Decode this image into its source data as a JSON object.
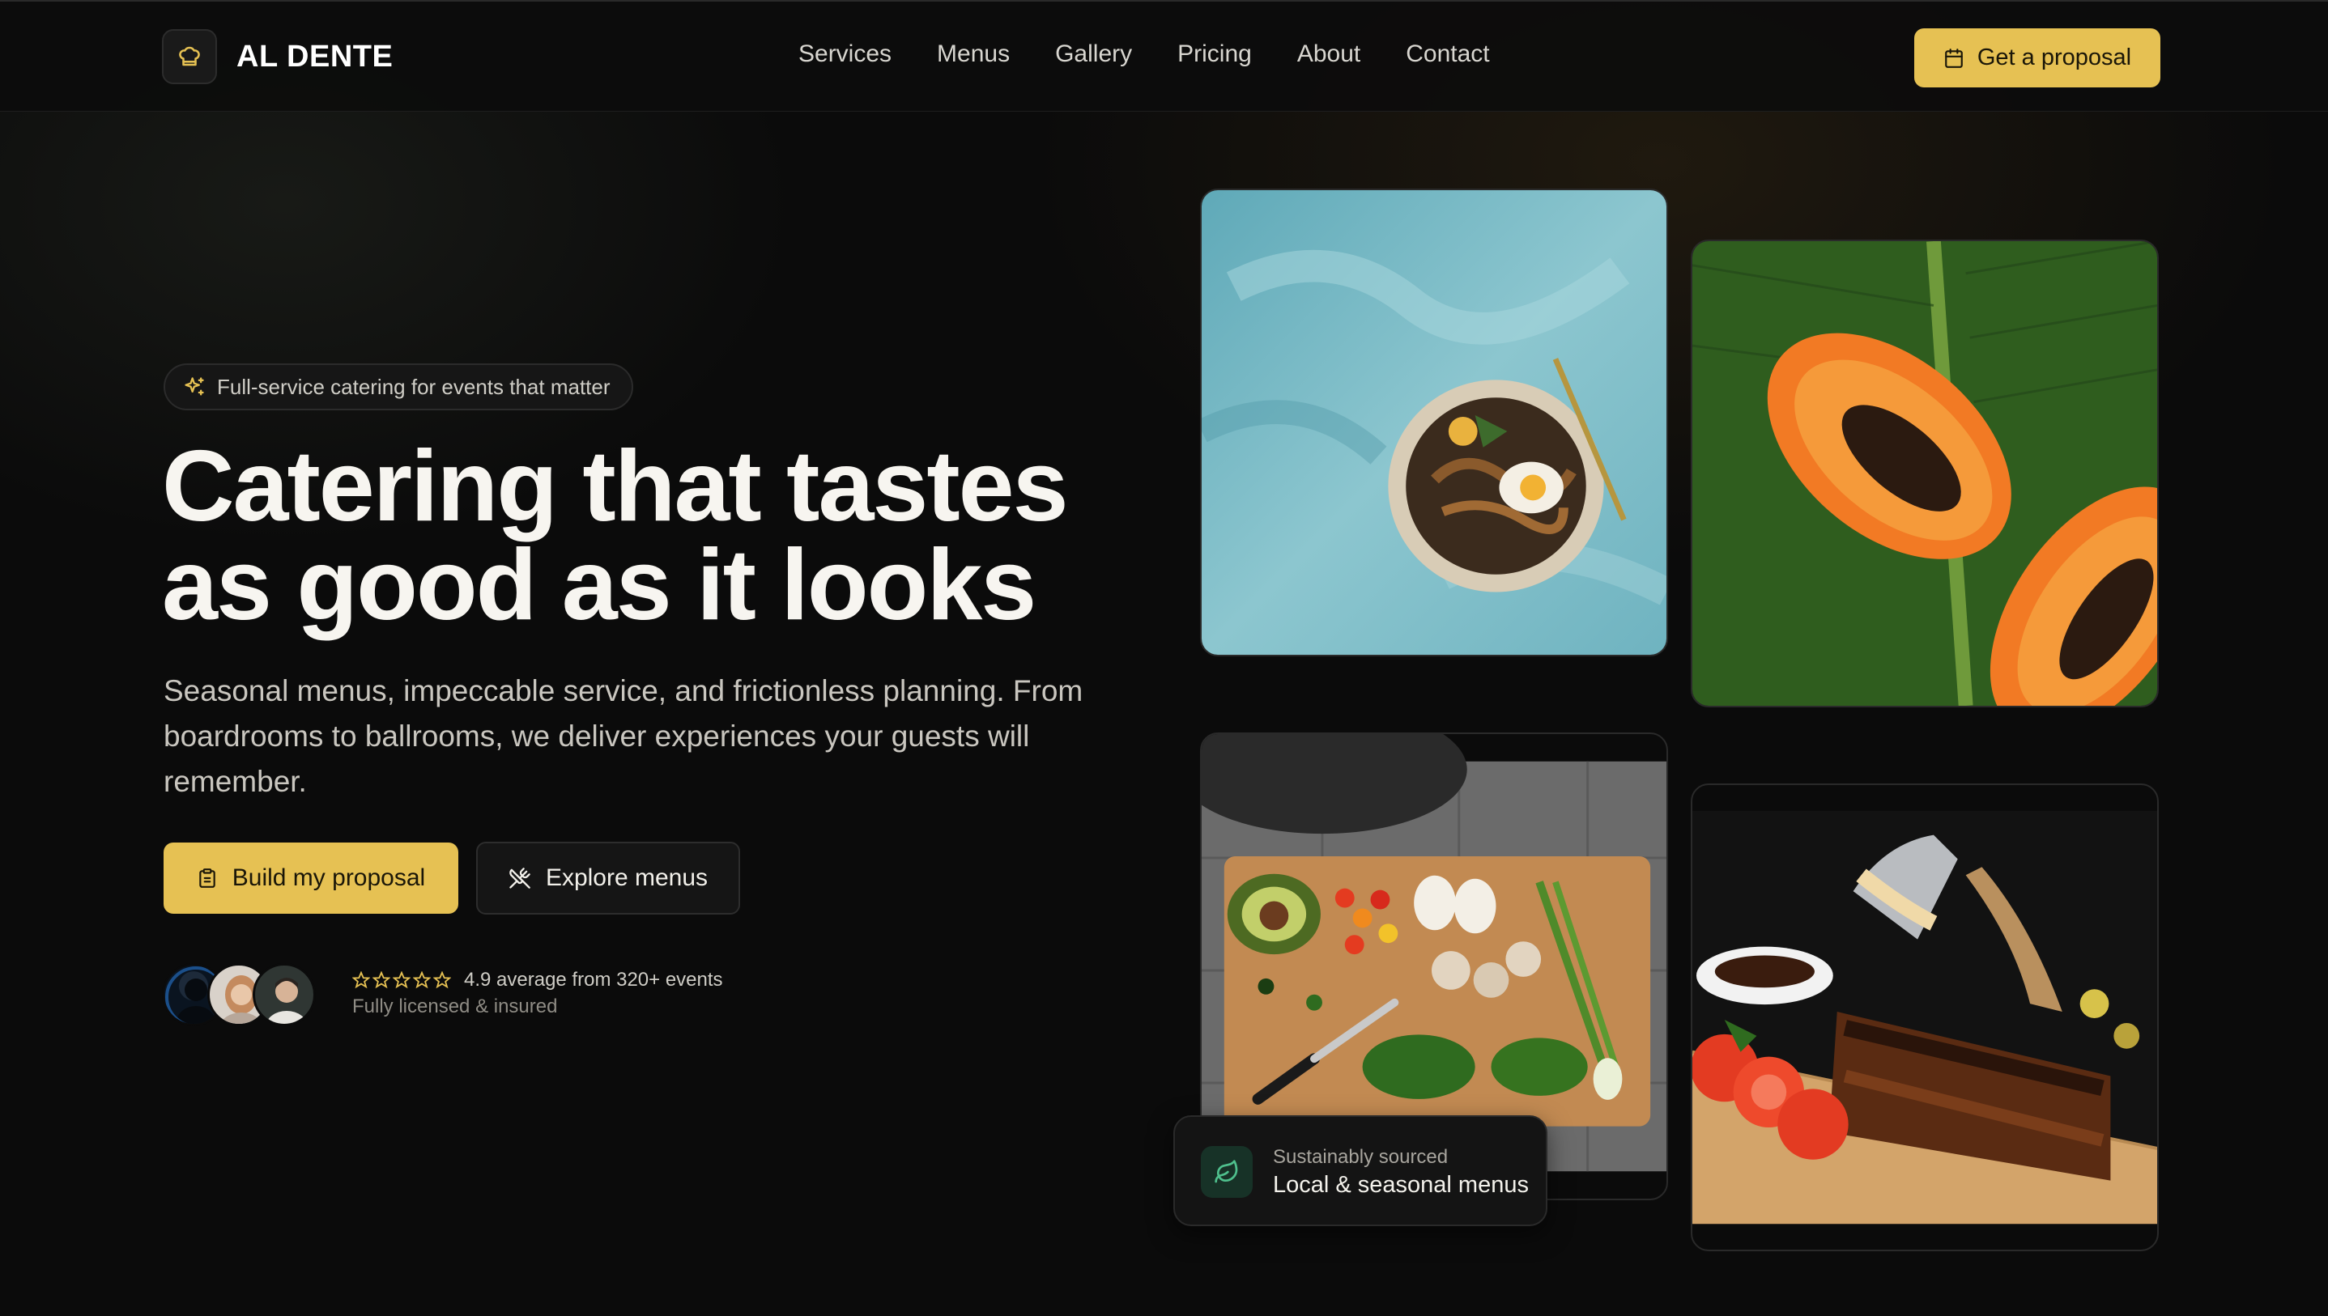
{
  "brand": {
    "name": "AL DENTE",
    "icon": "chef-hat-icon",
    "accent": "#e6c153"
  },
  "nav": {
    "links": [
      "Services",
      "Menus",
      "Gallery",
      "Pricing",
      "About",
      "Contact"
    ],
    "cta_label": "Get a proposal",
    "cta_icon": "calendar-icon"
  },
  "hero": {
    "pill_text": "Full-service catering for events that matter",
    "pill_icon": "sparkles-icon",
    "headline_line1": "Catering that tastes",
    "headline_line2": "as good as it looks",
    "subhead": "Seasonal menus, impeccable service, and frictionless planning. From boardrooms to ballrooms, we deliver experiences your guests will remember.",
    "primary_button": "Build my proposal",
    "primary_icon": "clipboard-icon",
    "secondary_button": "Explore menus",
    "secondary_icon": "utensils-crossed-icon",
    "rating_text": "4.9 average from 320+ events",
    "rating_stars": 5,
    "licensed_text": "Fully licensed & insured"
  },
  "gallery": {
    "images": [
      "noodle-bowl-photo",
      "papaya-photo",
      "cutting-board-vegetables-photo",
      "ribs-platter-photo"
    ]
  },
  "badge": {
    "small": "Sustainably sourced",
    "big": "Local & seasonal menus",
    "icon": "leaf-icon",
    "icon_color": "#4fc08d"
  }
}
